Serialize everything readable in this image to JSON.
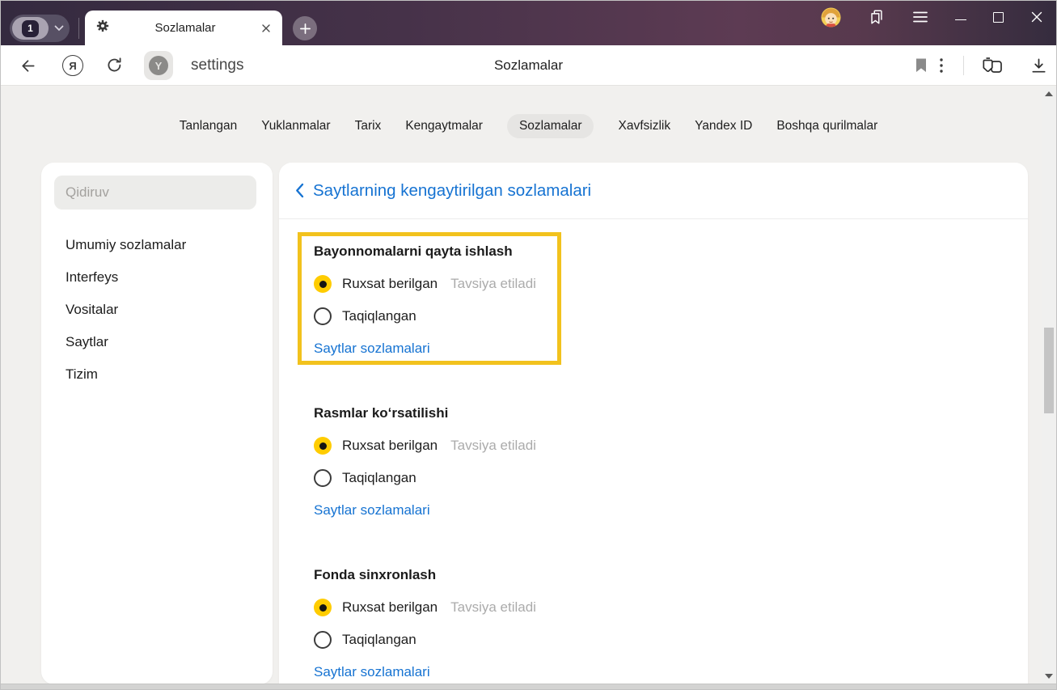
{
  "window": {
    "tab_count": "1",
    "tab": {
      "title": "Sozlamalar"
    }
  },
  "toolbar": {
    "url": "settings",
    "page_title": "Sozlamalar"
  },
  "icons": {
    "yandex_logo": "Я",
    "site_badge_logo": "Y"
  },
  "nav": {
    "items": [
      {
        "label": "Tanlangan",
        "active": false
      },
      {
        "label": "Yuklanmalar",
        "active": false
      },
      {
        "label": "Tarix",
        "active": false
      },
      {
        "label": "Kengaytmalar",
        "active": false
      },
      {
        "label": "Sozlamalar",
        "active": true
      },
      {
        "label": "Xavfsizlik",
        "active": false
      },
      {
        "label": "Yandex ID",
        "active": false
      },
      {
        "label": "Boshqa qurilmalar",
        "active": false
      }
    ]
  },
  "sidebar": {
    "search_placeholder": "Qidiruv",
    "items": [
      "Umumiy sozlamalar",
      "Interfeys",
      "Vositalar",
      "Saytlar",
      "Tizim"
    ]
  },
  "main": {
    "title": "Saytlarning kengaytirilgan sozlamalari",
    "sections": [
      {
        "title": "Bayonnomalarni qayta ishlash",
        "highlighted": true,
        "options": [
          {
            "label": "Ruxsat berilgan",
            "selected": true,
            "hint": "Tavsiya etiladi"
          },
          {
            "label": "Taqiqlangan",
            "selected": false
          }
        ],
        "link": "Saytlar sozlamalari"
      },
      {
        "title": "Rasmlar koʻrsatilishi",
        "highlighted": false,
        "options": [
          {
            "label": "Ruxsat berilgan",
            "selected": true,
            "hint": "Tavsiya etiladi"
          },
          {
            "label": "Taqiqlangan",
            "selected": false
          }
        ],
        "link": "Saytlar sozlamalari"
      },
      {
        "title": "Fonda sinxronlash",
        "highlighted": false,
        "options": [
          {
            "label": "Ruxsat berilgan",
            "selected": true,
            "hint": "Tavsiya etiladi"
          },
          {
            "label": "Taqiqlangan",
            "selected": false
          }
        ],
        "link": "Saytlar sozlamalari"
      }
    ]
  },
  "colors": {
    "highlight_border": "#f2c21d",
    "radio_selected": "#ffcc00",
    "link_blue": "#1673d2",
    "titlebar_left": "#342a3f",
    "titlebar_mid": "#5d3b53",
    "page_bg": "#f1f0ee"
  }
}
